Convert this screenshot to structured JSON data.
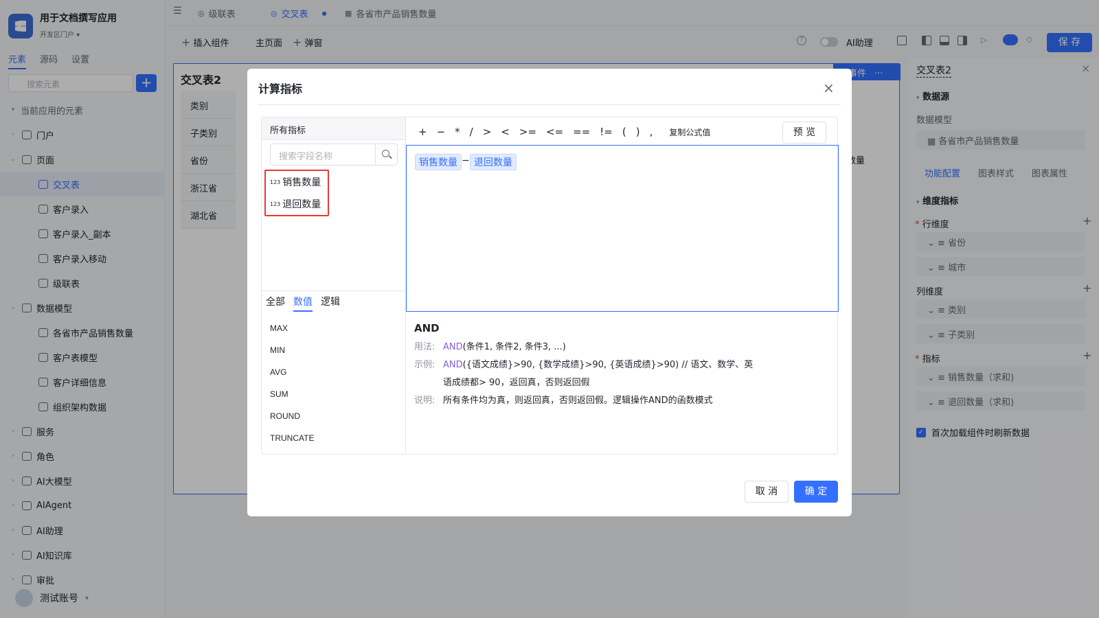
{
  "app": {
    "title": "用于文档撰写应用",
    "portal": "开发区门户 ▾"
  },
  "sidebar": {
    "tabs": [
      "元素",
      "源码",
      "设置"
    ],
    "search_placeholder": "搜索元素",
    "section_title": "当前应用的元素",
    "items": [
      {
        "label": "门户",
        "depth": 1,
        "caret": "›"
      },
      {
        "label": "页面",
        "depth": 1,
        "caret": "⌄"
      },
      {
        "label": "交叉表",
        "depth": 2,
        "caret": ""
      },
      {
        "label": "客户录入",
        "depth": 2,
        "caret": ""
      },
      {
        "label": "客户录入_副本",
        "depth": 2,
        "caret": ""
      },
      {
        "label": "客户录入移动",
        "depth": 2,
        "caret": ""
      },
      {
        "label": "级联表",
        "depth": 2,
        "caret": ""
      },
      {
        "label": "数据模型",
        "depth": 1,
        "caret": "⌄"
      },
      {
        "label": "各省市产品销售数量",
        "depth": 2,
        "caret": ""
      },
      {
        "label": "客户表模型",
        "depth": 2,
        "caret": ""
      },
      {
        "label": "客户详细信息",
        "depth": 2,
        "caret": ""
      },
      {
        "label": "组织架构数据",
        "depth": 2,
        "caret": ""
      },
      {
        "label": "服务",
        "depth": 1,
        "caret": "›"
      },
      {
        "label": "角色",
        "depth": 1,
        "caret": "›"
      },
      {
        "label": "AI大模型",
        "depth": 1,
        "caret": "›"
      },
      {
        "label": "AIAgent",
        "depth": 1,
        "caret": "›"
      },
      {
        "label": "AI助理",
        "depth": 1,
        "caret": "›"
      },
      {
        "label": "AI知识库",
        "depth": 1,
        "caret": "›"
      },
      {
        "label": "审批",
        "depth": 1,
        "caret": "›"
      }
    ],
    "user": "测试账号"
  },
  "tabs": [
    "级联表",
    "交叉表",
    "各省市产品销售数量"
  ],
  "toolbar": {
    "insert": "插入组件",
    "home": "主页面",
    "popup": "弹窗",
    "ai": "AI助理",
    "save": "保 存"
  },
  "canvas": {
    "title": "交叉表2",
    "event_btn": "事件",
    "rows": [
      "类别",
      "子类别",
      "省份",
      "浙江省",
      "湖北省"
    ],
    "col_hint": "数量"
  },
  "right_panel": {
    "title": "交叉表2",
    "datasource": "数据源",
    "model_label": "数据模型",
    "model_value": "各省市产品销售数量",
    "tabs": [
      "功能配置",
      "图表样式",
      "图表属性"
    ],
    "dim_section": "维度指标",
    "row_dim": "行维度",
    "row_items": [
      "省份",
      "城市"
    ],
    "col_dim": "列维度",
    "col_items": [
      "类别",
      "子类别"
    ],
    "metric": "指标",
    "metric_items": [
      "销售数量（求和)",
      "退回数量（求和)"
    ],
    "refresh": "首次加载组件时刷新数据"
  },
  "modal": {
    "title": "计算指标",
    "all_metrics": "所有指标",
    "search_placeholder": "搜索字段名称",
    "fields": [
      "销售数量",
      "退回数量"
    ],
    "func_tabs": [
      "全部",
      "数值",
      "逻辑"
    ],
    "functions": [
      "MAX",
      "MIN",
      "AVG",
      "SUM",
      "ROUND",
      "TRUNCATE"
    ],
    "operators": [
      "+",
      "−",
      "*",
      "/",
      ">",
      "<",
      ">=",
      "<=",
      "==",
      "!=",
      "(",
      ")",
      ","
    ],
    "copy_formula": "复制公式值",
    "preview": "预 览",
    "formula": {
      "left": "销售数量",
      "op": "−",
      "right": "退回数量"
    },
    "doc": {
      "name": "AND",
      "usage_key": "用法:",
      "usage_fn": "AND",
      "usage_rest": "(条件1, 条件2, 条件3, ...)",
      "example_key": "示例:",
      "example_fn": "AND",
      "example_rest": "({语文成绩}>90, {数学成绩}>90, {英语成绩}>90) // 语文、数学、英",
      "example_cont": "语成绩都> 90，返回真，否则返回假",
      "desc_key": "说明:",
      "desc": "所有条件均为真，则返回真，否则返回假。逻辑操作AND的函数模式"
    },
    "cancel": "取 消",
    "ok": "确 定"
  }
}
